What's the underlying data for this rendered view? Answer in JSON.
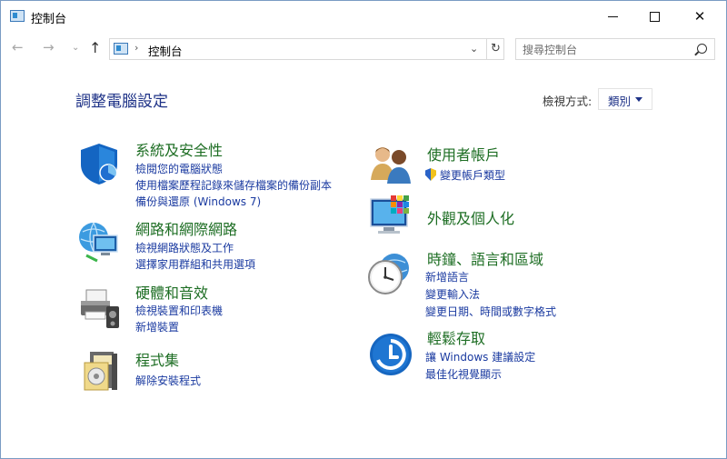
{
  "window": {
    "title": "控制台"
  },
  "nav": {
    "back_icon": "back-arrow-icon",
    "forward_icon": "forward-arrow-icon",
    "up_icon": "up-arrow-icon",
    "address": "控制台",
    "search_placeholder": "搜尋控制台"
  },
  "main": {
    "title": "調整電腦設定",
    "view_label": "檢視方式:",
    "view_value": "類別"
  },
  "categories": {
    "security": {
      "title": "系統及安全性",
      "links": [
        "檢閱您的電腦狀態",
        "使用檔案歷程記錄來儲存檔案的備份副本",
        "備份與還原 (Windows 7)"
      ]
    },
    "network": {
      "title": "網路和網際網路",
      "links": [
        "檢視網路狀態及工作",
        "選擇家用群組和共用選項"
      ]
    },
    "hardware": {
      "title": "硬體和音效",
      "links": [
        "檢視裝置和印表機",
        "新增裝置"
      ]
    },
    "programs": {
      "title": "程式集",
      "links": [
        "解除安裝程式"
      ]
    },
    "accounts": {
      "title": "使用者帳戶",
      "links": [
        "變更帳戶類型"
      ]
    },
    "appearance": {
      "title": "外觀及個人化",
      "links": []
    },
    "clock": {
      "title": "時鐘、語言和區域",
      "links": [
        "新增語言",
        "變更輸入法",
        "變更日期、時間或數字格式"
      ]
    },
    "ease": {
      "title": "輕鬆存取",
      "links": [
        "讓 Windows 建議設定",
        "最佳化視覺顯示"
      ]
    }
  },
  "colors": {
    "category_title": "#1e6e24",
    "link": "#1a3aa0",
    "heading": "#1e3287"
  }
}
